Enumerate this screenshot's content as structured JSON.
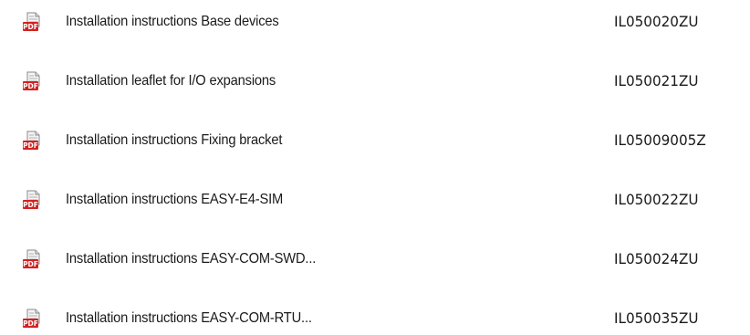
{
  "icons": {
    "document": "pdf-document-icon",
    "badge_text": "PDF"
  },
  "colors": {
    "pdf_badge": "#d42020",
    "text": "#1a1a1a",
    "background": "#ffffff"
  },
  "documents": [
    {
      "title": "Installation instructions Base devices",
      "code": "IL050020ZU"
    },
    {
      "title": "Installation leaflet for I/O expansions",
      "code": "IL050021ZU"
    },
    {
      "title": "Installation instructions Fixing bracket",
      "code": "IL05009005Z"
    },
    {
      "title": "Installation instructions EASY-E4-SIM",
      "code": "IL050022ZU"
    },
    {
      "title": "Installation instructions EASY-COM-SWD...",
      "code": "IL050024ZU"
    },
    {
      "title": "Installation instructions EASY-COM-RTU...",
      "code": "IL050035ZU"
    }
  ]
}
